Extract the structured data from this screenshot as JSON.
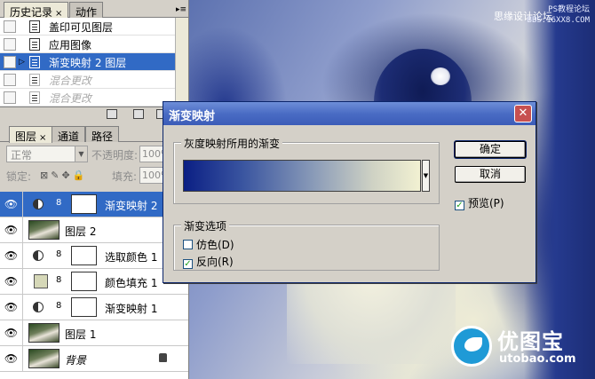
{
  "history_palette": {
    "tabs": [
      {
        "label": "历史记录",
        "close": "×"
      },
      {
        "label": "动作"
      }
    ],
    "items": [
      {
        "label": "盖印可见图层",
        "state": "normal"
      },
      {
        "label": "应用图像",
        "state": "normal"
      },
      {
        "label": "渐变映射 2 图层",
        "state": "selected"
      },
      {
        "label": "混合更改",
        "state": "dimmed"
      },
      {
        "label": "混合更改",
        "state": "dimmed"
      }
    ]
  },
  "layers_palette": {
    "tabs": [
      {
        "label": "图层",
        "close": "×"
      },
      {
        "label": "通道"
      },
      {
        "label": "路径"
      }
    ],
    "blend_mode": "正常",
    "opacity_label": "不透明度:",
    "opacity_value": "100%",
    "lock_label": "锁定:",
    "fill_label": "填充:",
    "fill_value": "100%",
    "layers": [
      {
        "name": "渐变映射 2",
        "type": "adjustment",
        "selected": true
      },
      {
        "name": "图层 2",
        "type": "photo"
      },
      {
        "name": "选取颜色 1",
        "type": "adjustment"
      },
      {
        "name": "颜色填充 1",
        "type": "fill"
      },
      {
        "name": "渐变映射 1",
        "type": "adjustment"
      },
      {
        "name": "图层 1",
        "type": "photo"
      },
      {
        "name": "背景",
        "type": "background"
      }
    ]
  },
  "dialog": {
    "title": "渐变映射",
    "gradient_group_title": "灰度映射所用的渐变",
    "options_group_title": "渐变选项",
    "dither_label": "仿色(D)",
    "dither_checked": false,
    "reverse_label": "反向(R)",
    "reverse_checked": true,
    "ok_label": "确定",
    "cancel_label": "取消",
    "preview_label": "预览(P)",
    "preview_checked": true,
    "gradient_colors": [
      "#0b1f84",
      "#f2f1d2"
    ]
  },
  "canvas": {
    "watermark_cn": "思缘设计论坛",
    "watermark_ps": "PS教程论坛",
    "watermark_url": "BBS.16XX8.COM",
    "logo_cn": "优图宝",
    "logo_en": "utobao.com"
  }
}
